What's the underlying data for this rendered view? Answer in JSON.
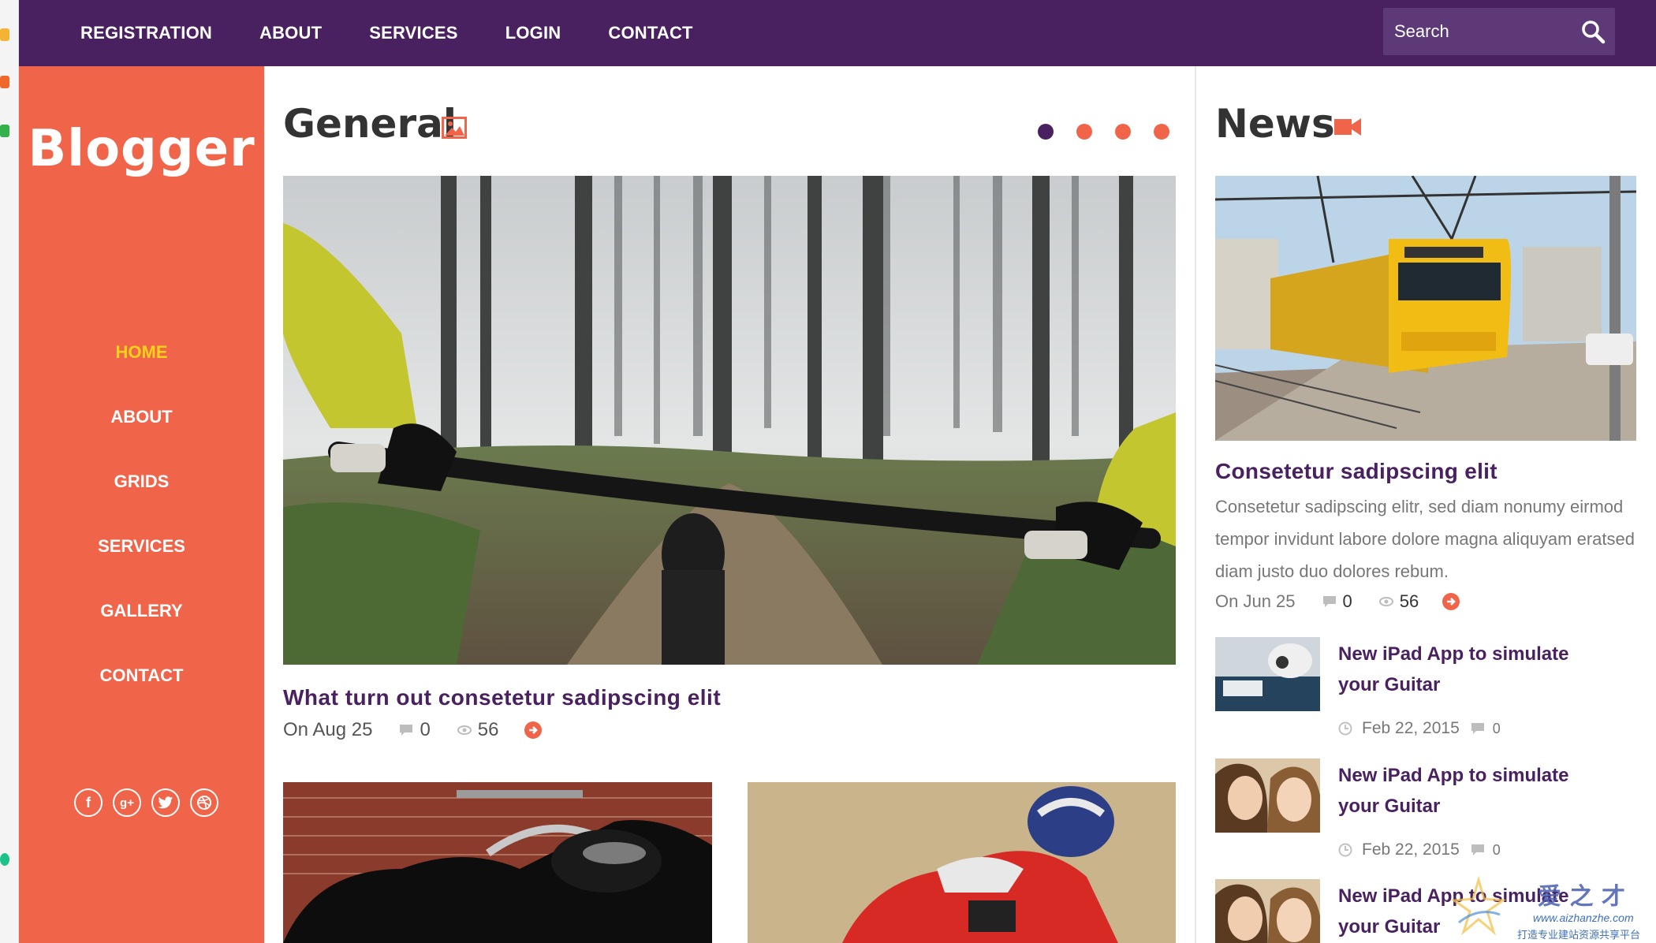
{
  "nav": {
    "items": [
      "REGISTRATION",
      "ABOUT",
      "SERVICES",
      "LOGIN",
      "CONTACT"
    ],
    "search_placeholder": "Search"
  },
  "sidebar": {
    "logo": "Blogger",
    "menu": [
      {
        "label": "HOME",
        "active": true
      },
      {
        "label": "ABOUT",
        "active": false
      },
      {
        "label": "GRIDS",
        "active": false
      },
      {
        "label": "SERVICES",
        "active": false
      },
      {
        "label": "GALLERY",
        "active": false
      },
      {
        "label": "CONTACT",
        "active": false
      }
    ],
    "socials": [
      "facebook-icon",
      "google-plus-icon",
      "twitter-icon",
      "dribbble-icon"
    ]
  },
  "general": {
    "title": "General",
    "slider_dots": 4,
    "active_dot": 0,
    "post": {
      "title": "What turn out consetetur sadipscing elit",
      "date": "On Aug 25",
      "comments": "0",
      "views": "56"
    }
  },
  "news": {
    "title": "News",
    "featured": {
      "title": "Consetetur sadipscing elit",
      "desc": "Consetetur sadipscing elitr, sed diam nonumy eirmod tempor invidunt labore dolore magna aliquyam eratsed diam justo duo dolores rebum.",
      "date": "On Jun 25",
      "comments": "0",
      "views": "56"
    },
    "items": [
      {
        "title": "New iPad App to simulate your Guitar",
        "date": "Feb 22, 2015",
        "comments": "0"
      },
      {
        "title": "New iPad App to simulate your Guitar",
        "date": "Feb 22, 2015",
        "comments": "0"
      },
      {
        "title": "New iPad App to simulate your Guitar",
        "date": "",
        "comments": ""
      }
    ]
  },
  "watermark": {
    "brand": "爱 之 才",
    "site": "www.aizhanzhe.com",
    "tagline": "打造专业建站资源共享平台"
  },
  "colors": {
    "nav_bg": "#4a2160",
    "sidebar_bg": "#f0654a",
    "accent": "#f0654a",
    "active_link": "#ffd11a",
    "title_purple": "#4a2160"
  }
}
